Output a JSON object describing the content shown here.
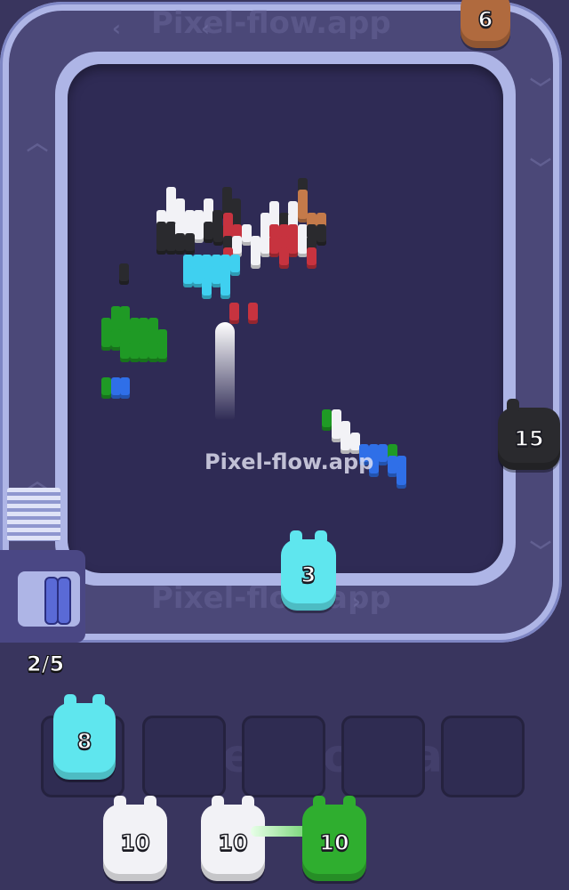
{
  "watermark": "Pixel-flow.app",
  "progress": {
    "collected": 2,
    "total": 5,
    "label": "2/5"
  },
  "conveyor_shooters": [
    {
      "color": "brown",
      "count": "6"
    },
    {
      "color": "black",
      "count": "15"
    },
    {
      "color": "cyan",
      "count": "3"
    }
  ],
  "dock_spools": 2,
  "slots": [
    {
      "occupied": true,
      "color": "cyan",
      "count": "8"
    },
    {
      "occupied": false
    },
    {
      "occupied": false
    },
    {
      "occupied": false
    },
    {
      "occupied": false
    }
  ],
  "queue": [
    {
      "color": "white",
      "count": "10"
    },
    {
      "color": "white",
      "count": "10"
    },
    {
      "color": "green",
      "count": "10"
    }
  ],
  "colors": {
    "background": "#39355e",
    "board": "#2f2b55",
    "track": "#aeb5e6",
    "cyan": "#5fe6ee",
    "white": "#f2f2f6",
    "green": "#2fae2f",
    "black": "#2a2a2e",
    "brown": "#b06a3e"
  }
}
